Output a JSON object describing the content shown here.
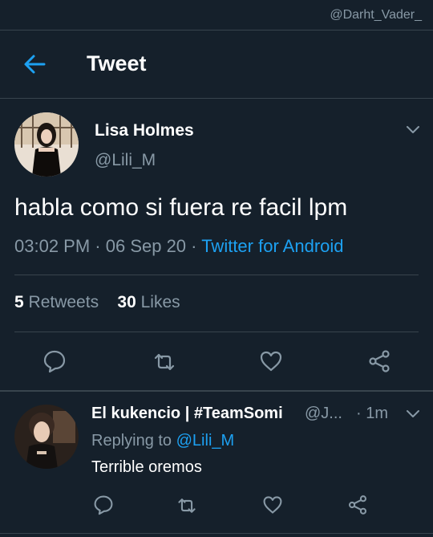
{
  "watermark": "@Darht_Vader_",
  "header": {
    "title": "Tweet"
  },
  "tweet": {
    "author_name": "Lisa Holmes",
    "author_handle": "@Lili_M",
    "text": "habla como si fuera re facil lpm",
    "time": "03:02 PM",
    "separator1": " · ",
    "date": "06 Sep 20",
    "separator2": " · ",
    "source": "Twitter for Android",
    "retweet_count": "5",
    "retweet_label": "Retweets",
    "like_count": "30",
    "like_label": "Likes"
  },
  "reply": {
    "author_name": "El kukencio | #TeamSomi",
    "author_handle": "@J...",
    "time": "· 1m",
    "replying_prefix": "Replying to",
    "replying_handle": "@Lili_M",
    "text": "Terrible oremos"
  },
  "colors": {
    "background": "#15202b",
    "divider": "#38444d",
    "secondary_text": "#8899a6",
    "accent": "#1da1f2"
  },
  "icons": {
    "back": "arrow-left-icon",
    "menu": "chevron-down-icon",
    "reply": "comment-icon",
    "retweet": "retweet-icon",
    "like": "heart-icon",
    "share": "share-icon"
  }
}
